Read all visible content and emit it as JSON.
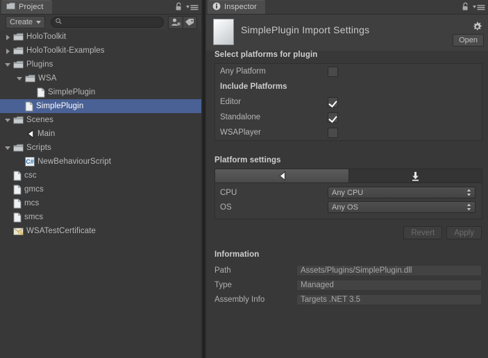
{
  "project_panel": {
    "tab": {
      "label": "Project",
      "icon": "folder-icon"
    },
    "tabbar_icons": [
      "lock-icon",
      "menu-icon"
    ],
    "toolbar": {
      "create_label": "Create",
      "create_caret": "chevron-down-icon",
      "search_placeholder": "",
      "search_value": "",
      "search_icon": "search-icon",
      "buttons": [
        "favorite-icon",
        "label-icon"
      ]
    },
    "tree": [
      {
        "label": "HoloToolkit",
        "icon": "folder-icon",
        "arrow": "right",
        "indent": 0,
        "selected": false
      },
      {
        "label": "HoloToolkit-Examples",
        "icon": "folder-icon",
        "arrow": "right",
        "indent": 0,
        "selected": false
      },
      {
        "label": "Plugins",
        "icon": "folder-icon",
        "arrow": "down",
        "indent": 0,
        "selected": false
      },
      {
        "label": "WSA",
        "icon": "folder-icon",
        "arrow": "down",
        "indent": 1,
        "selected": false
      },
      {
        "label": "SimplePlugin",
        "icon": "file-icon",
        "arrow": "none",
        "indent": 2,
        "selected": false
      },
      {
        "label": "SimplePlugin",
        "icon": "file-icon",
        "arrow": "none",
        "indent": 1,
        "selected": true
      },
      {
        "label": "Scenes",
        "icon": "folder-icon",
        "arrow": "down",
        "indent": 0,
        "selected": false
      },
      {
        "label": "Main",
        "icon": "unity-icon",
        "arrow": "none",
        "indent": 1,
        "selected": false
      },
      {
        "label": "Scripts",
        "icon": "folder-icon",
        "arrow": "down",
        "indent": 0,
        "selected": false
      },
      {
        "label": "NewBehaviourScript",
        "icon": "csharp-icon",
        "arrow": "none",
        "indent": 1,
        "selected": false
      },
      {
        "label": "csc",
        "icon": "file-icon",
        "arrow": "none",
        "indent": 0,
        "selected": false
      },
      {
        "label": "gmcs",
        "icon": "file-icon",
        "arrow": "none",
        "indent": 0,
        "selected": false
      },
      {
        "label": "mcs",
        "icon": "file-icon",
        "arrow": "none",
        "indent": 0,
        "selected": false
      },
      {
        "label": "smcs",
        "icon": "file-icon",
        "arrow": "none",
        "indent": 0,
        "selected": false
      },
      {
        "label": "WSATestCertificate",
        "icon": "certificate-icon",
        "arrow": "none",
        "indent": 0,
        "selected": false
      }
    ]
  },
  "inspector": {
    "tab": {
      "label": "Inspector",
      "icon": "info-icon"
    },
    "tabbar_icons": [
      "lock-icon",
      "menu-icon"
    ],
    "header": {
      "title": "SimplePlugin Import Settings",
      "asset_icon": "dll-file-icon",
      "gear_icon": "gear-icon",
      "open_button": "Open"
    },
    "select_platforms": {
      "title": "Select platforms for plugin",
      "any_platform": {
        "label": "Any Platform",
        "checked": false
      },
      "include_title": "Include Platforms",
      "platforms": [
        {
          "label": "Editor",
          "checked": true
        },
        {
          "label": "Standalone",
          "checked": true
        },
        {
          "label": "WSAPlayer",
          "checked": false
        }
      ]
    },
    "platform_settings": {
      "title": "Platform settings",
      "tabs": [
        {
          "icon": "unity-icon",
          "active": true
        },
        {
          "icon": "download-icon",
          "active": false
        }
      ],
      "fields": [
        {
          "label": "CPU",
          "value": "Any CPU"
        },
        {
          "label": "OS",
          "value": "Any OS"
        }
      ],
      "revert_button": "Revert",
      "apply_button": "Apply"
    },
    "information": {
      "title": "Information",
      "rows": [
        {
          "label": "Path",
          "value": "Assets/Plugins/SimplePlugin.dll"
        },
        {
          "label": "Type",
          "value": "Managed"
        },
        {
          "label": "Assembly Info",
          "value": "Targets .NET 3.5"
        }
      ]
    }
  },
  "colors": {
    "background": "#383838",
    "panel": "#3b3b3b",
    "selection": "#4a6196",
    "text": "#b4b4b4",
    "divider": "#202020"
  }
}
